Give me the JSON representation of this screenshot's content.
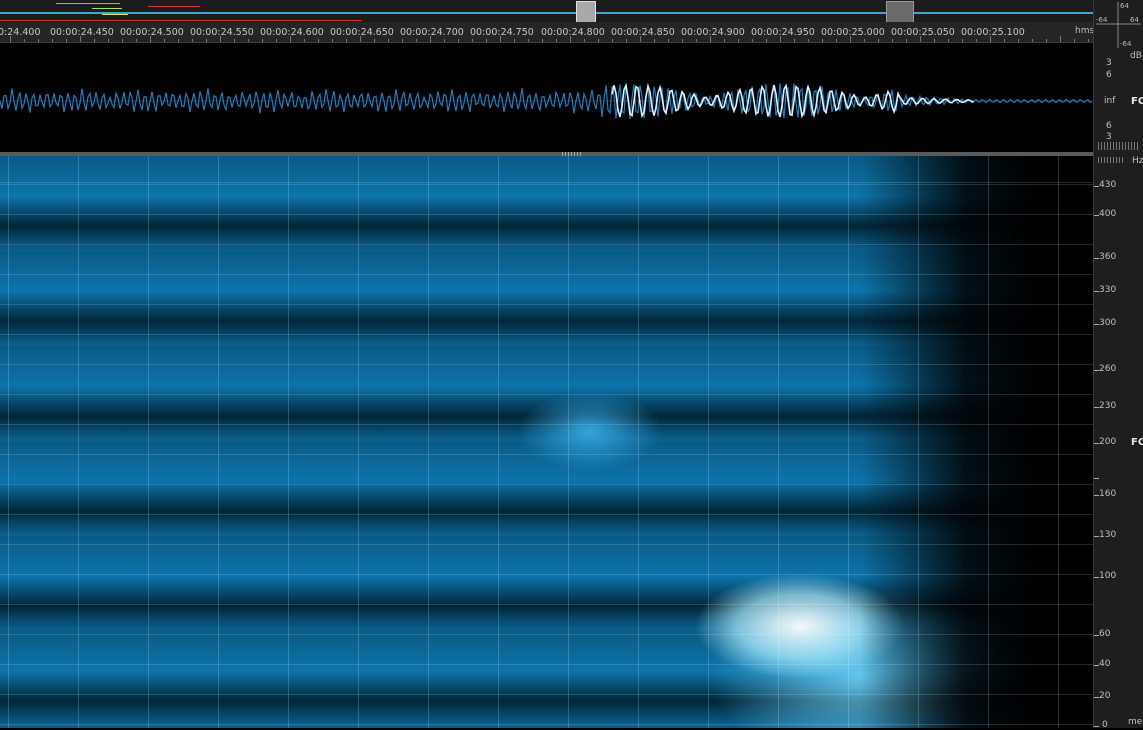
{
  "ruler": {
    "unit": "hms",
    "times": [
      "0:24.400",
      "00:00:24.450",
      "00:00:24.500",
      "00:00:24.550",
      "00:00:24.600",
      "00:00:24.650",
      "00:00:24.700",
      "00:00:24.750",
      "00:00:24.800",
      "00:00:24.850",
      "00:00:24.900",
      "00:00:24.950",
      "00:00:25.000",
      "00:00:25.050",
      "00:00:25.100"
    ]
  },
  "waveform_scale": {
    "unit": "dB",
    "top": [
      "3",
      "6"
    ],
    "center": "inf",
    "bottom": [
      "6",
      "3"
    ],
    "channel": "FC"
  },
  "spectrogram_scale": {
    "unit": "Hz",
    "labels": [
      "430",
      "400",
      "360",
      "330",
      "300",
      "260",
      "230",
      "200",
      "160",
      "130",
      "100",
      "60",
      "40",
      "20",
      "0"
    ],
    "channel": "FC",
    "bottom_unit": "me"
  },
  "corner": {
    "labels": [
      "64",
      "-64",
      "-64",
      "64"
    ]
  },
  "colors": {
    "overview_track": "#39a9d8",
    "waveform": "#1d7fc0",
    "waveform_highlight": "#d8f4ff",
    "spectrogram_low": "#02304a",
    "spectrogram_high": "#ffffff"
  }
}
